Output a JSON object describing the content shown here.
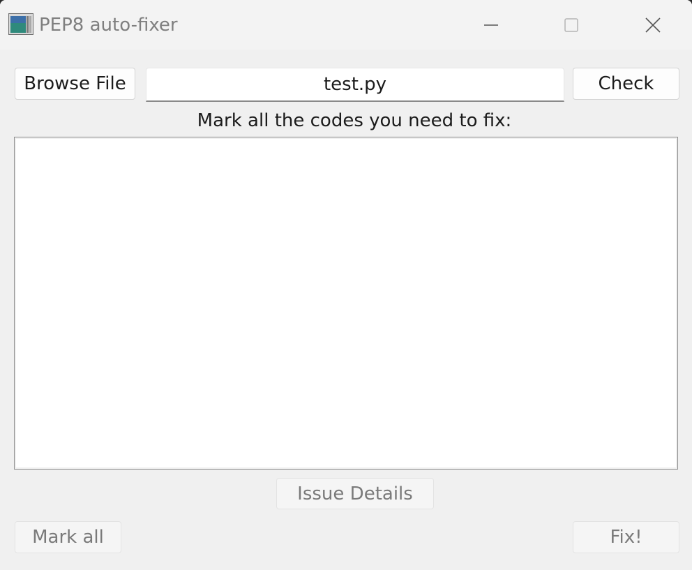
{
  "window": {
    "title": "PEP8 auto-fixer",
    "icon": "app-icon",
    "controls": [
      "minimize-icon",
      "maximize-icon",
      "close-icon"
    ]
  },
  "toolbar": {
    "browse_label": "Browse File",
    "file_value": "test.py",
    "check_label": "Check"
  },
  "main": {
    "prompt": "Mark all the codes you need to fix:",
    "issues": []
  },
  "footer": {
    "details_label": "Issue Details",
    "mark_all_label": "Mark all",
    "fix_label": "Fix!"
  }
}
